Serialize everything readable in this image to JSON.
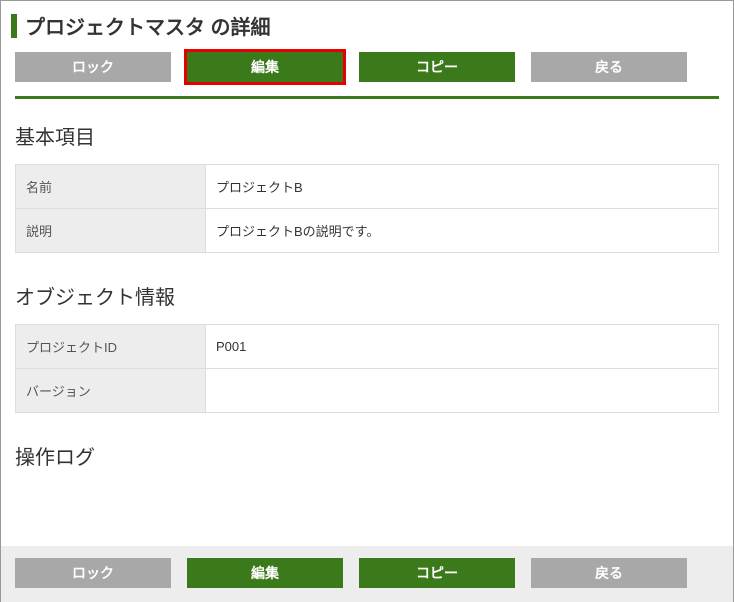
{
  "header": {
    "title": "プロジェクトマスタ の詳細"
  },
  "toolbar": {
    "lock": "ロック",
    "edit": "編集",
    "copy": "コピー",
    "back": "戻る"
  },
  "sections": {
    "basic": {
      "title": "基本項目",
      "rows": [
        {
          "label": "名前",
          "value": "プロジェクトB"
        },
        {
          "label": "説明",
          "value": "プロジェクトBの説明です。"
        }
      ]
    },
    "object": {
      "title": "オブジェクト情報",
      "rows": [
        {
          "label": "プロジェクトID",
          "value": "P001"
        },
        {
          "label": "バージョン",
          "value": ""
        }
      ]
    },
    "log": {
      "title": "操作ログ"
    }
  },
  "colors": {
    "accent": "#3a7a1a",
    "highlight": "#e60000",
    "gray": "#a8a8a8"
  }
}
